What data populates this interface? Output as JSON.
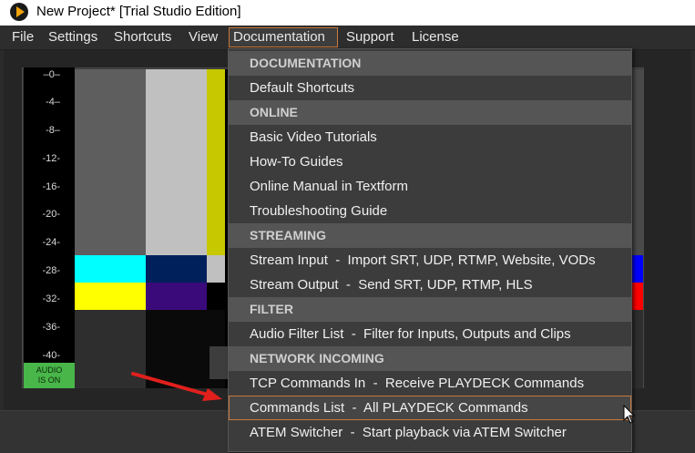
{
  "window": {
    "title": "New Project* [Trial Studio Edition]"
  },
  "menubar": {
    "items": [
      "File",
      "Settings",
      "Shortcuts",
      "View",
      "Documentation",
      "Support",
      "License"
    ]
  },
  "meter": {
    "labels": [
      "–0–",
      "-4–",
      "-8–",
      "-12-",
      "-16-",
      "-20-",
      "-24-",
      "-28-",
      "-32-",
      "-36-",
      "-40-"
    ],
    "badge_line1": "AUDIO",
    "badge_line2": "IS ON",
    "badge_color": "#49b649"
  },
  "dropdown": {
    "sections": [
      {
        "header": "DOCUMENTATION",
        "items": [
          "Default Shortcuts"
        ]
      },
      {
        "header": "ONLINE",
        "items": [
          "Basic Video Tutorials",
          "How-To Guides",
          "Online Manual in Textform",
          "Troubleshooting Guide"
        ]
      },
      {
        "header": "STREAMING",
        "items": [
          "Stream Input  -  Import SRT, UDP, RTMP, Website, VODs",
          "Stream Output  -  Send SRT, UDP, RTMP, HLS"
        ]
      },
      {
        "header": "FILTER",
        "items": [
          "Audio Filter List  -  Filter for Inputs, Outputs and Clips"
        ]
      },
      {
        "header": "NETWORK INCOMING",
        "items": [
          "TCP Commands In  -  Receive PLAYDECK Commands",
          "Commands List  -  All PLAYDECK Commands",
          "ATEM Switcher  -  Start playback via ATEM Switcher"
        ]
      }
    ],
    "highlighted_item": "Commands List  -  All PLAYDECK Commands",
    "highlight_color": "#c8783c"
  },
  "colors": {
    "accent": "#c8783c",
    "arrow": "#e0201c"
  }
}
